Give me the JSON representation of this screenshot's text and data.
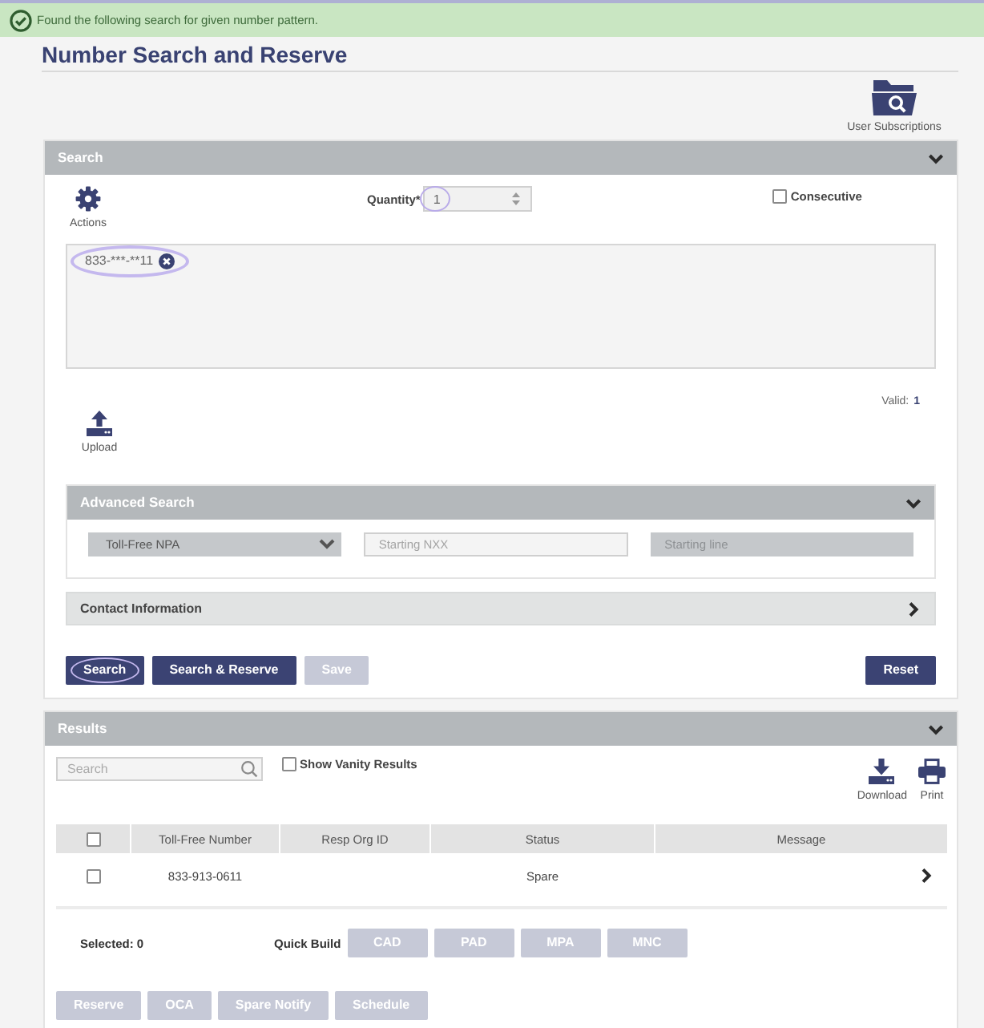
{
  "alert": {
    "message": "Found the following search for given number pattern."
  },
  "title": "Number Search and Reserve",
  "toolbar": [
    {
      "label": "User Subscriptions"
    }
  ],
  "search_panel": {
    "title": "Search",
    "expanded": true,
    "actions_label": "Actions",
    "quantity": {
      "label": "Quantity*",
      "value": "1",
      "highlighted": true
    },
    "consecutive": {
      "label": "Consecutive",
      "checked": false
    },
    "patterns": [
      {
        "text": "833-***-**11",
        "highlighted": true
      }
    ],
    "valid_label": "Valid:",
    "valid_count": "1",
    "upload_label": "Upload",
    "advanced_search": {
      "title": "Advanced Search",
      "expanded": true,
      "fields": [
        {
          "kind": "select",
          "value": "Toll-Free NPA",
          "disabled": false
        },
        {
          "kind": "input",
          "placeholder": "Starting NXX",
          "disabled": false
        },
        {
          "kind": "input",
          "placeholder": "Starting line",
          "disabled": true
        }
      ]
    },
    "contact_information": {
      "title": "Contact Information",
      "expanded": false
    },
    "buttons": [
      {
        "label": "Search",
        "disabled": false,
        "highlighted": true
      },
      {
        "label": "Search & Reserve",
        "disabled": false,
        "highlighted": false
      },
      {
        "label": "Save",
        "disabled": true,
        "highlighted": false
      }
    ],
    "reset_button": {
      "label": "Reset",
      "disabled": false
    }
  },
  "results_panel": {
    "title": "Results",
    "expanded": true,
    "search": {
      "placeholder": "Search"
    },
    "show_vanity": {
      "label": "Show Vanity Results",
      "checked": false
    },
    "tools": [
      {
        "kind": "download",
        "label": "Download"
      },
      {
        "kind": "print",
        "label": "Print"
      }
    ],
    "table": {
      "all_selected": false,
      "columns": [
        "Toll-Free Number",
        "Resp Org ID",
        "Status",
        "Message"
      ],
      "rows": [
        {
          "selected": false,
          "toll_free_number": "833-913-0611",
          "status": "Spare"
        }
      ]
    },
    "selected_text": "Selected: 0",
    "quick_build": {
      "label": "Quick Build",
      "buttons": [
        {
          "label": "CAD",
          "disabled": true
        },
        {
          "label": "PAD",
          "disabled": true
        },
        {
          "label": "MPA",
          "disabled": true
        },
        {
          "label": "MNC",
          "disabled": true
        }
      ]
    },
    "actions": [
      {
        "label": "Reserve",
        "disabled": true
      },
      {
        "label": "OCA",
        "disabled": true
      },
      {
        "label": "Spare Notify",
        "disabled": true
      },
      {
        "label": "Schedule",
        "disabled": true
      }
    ]
  }
}
